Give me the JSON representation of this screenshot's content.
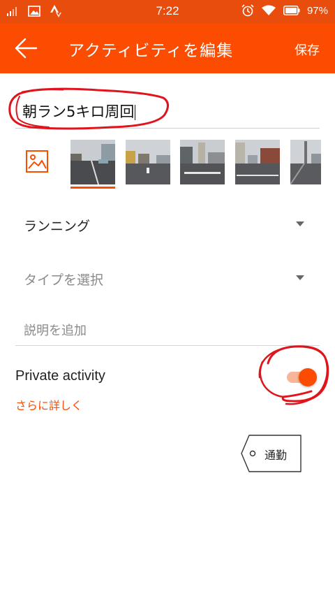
{
  "status_bar": {
    "time": "7:22",
    "battery": "97%",
    "icons": [
      "signal-icon",
      "gallery-notification-icon",
      "strava-notification-icon",
      "alarm-icon",
      "wifi-icon",
      "battery-icon"
    ]
  },
  "app_bar": {
    "title": "アクティビティを編集",
    "save_label": "保存",
    "back_icon": "back-arrow-icon"
  },
  "form": {
    "title_value": "朝ラン5キロ周回",
    "photos": {
      "add_icon": "add-photo-icon",
      "count": 5,
      "selected_index": 0
    },
    "activity_type": "ランニング",
    "workout_type_placeholder": "タイプを選択",
    "description_placeholder": "説明を追加"
  },
  "privacy": {
    "label": "Private activity",
    "learn_more": "さらに詳しく",
    "enabled": true
  },
  "commute": {
    "label": "通勤"
  },
  "colors": {
    "brand_orange": "#fc4c02",
    "status_bar": "#e84d0e",
    "annotation_red": "#e0141c"
  }
}
